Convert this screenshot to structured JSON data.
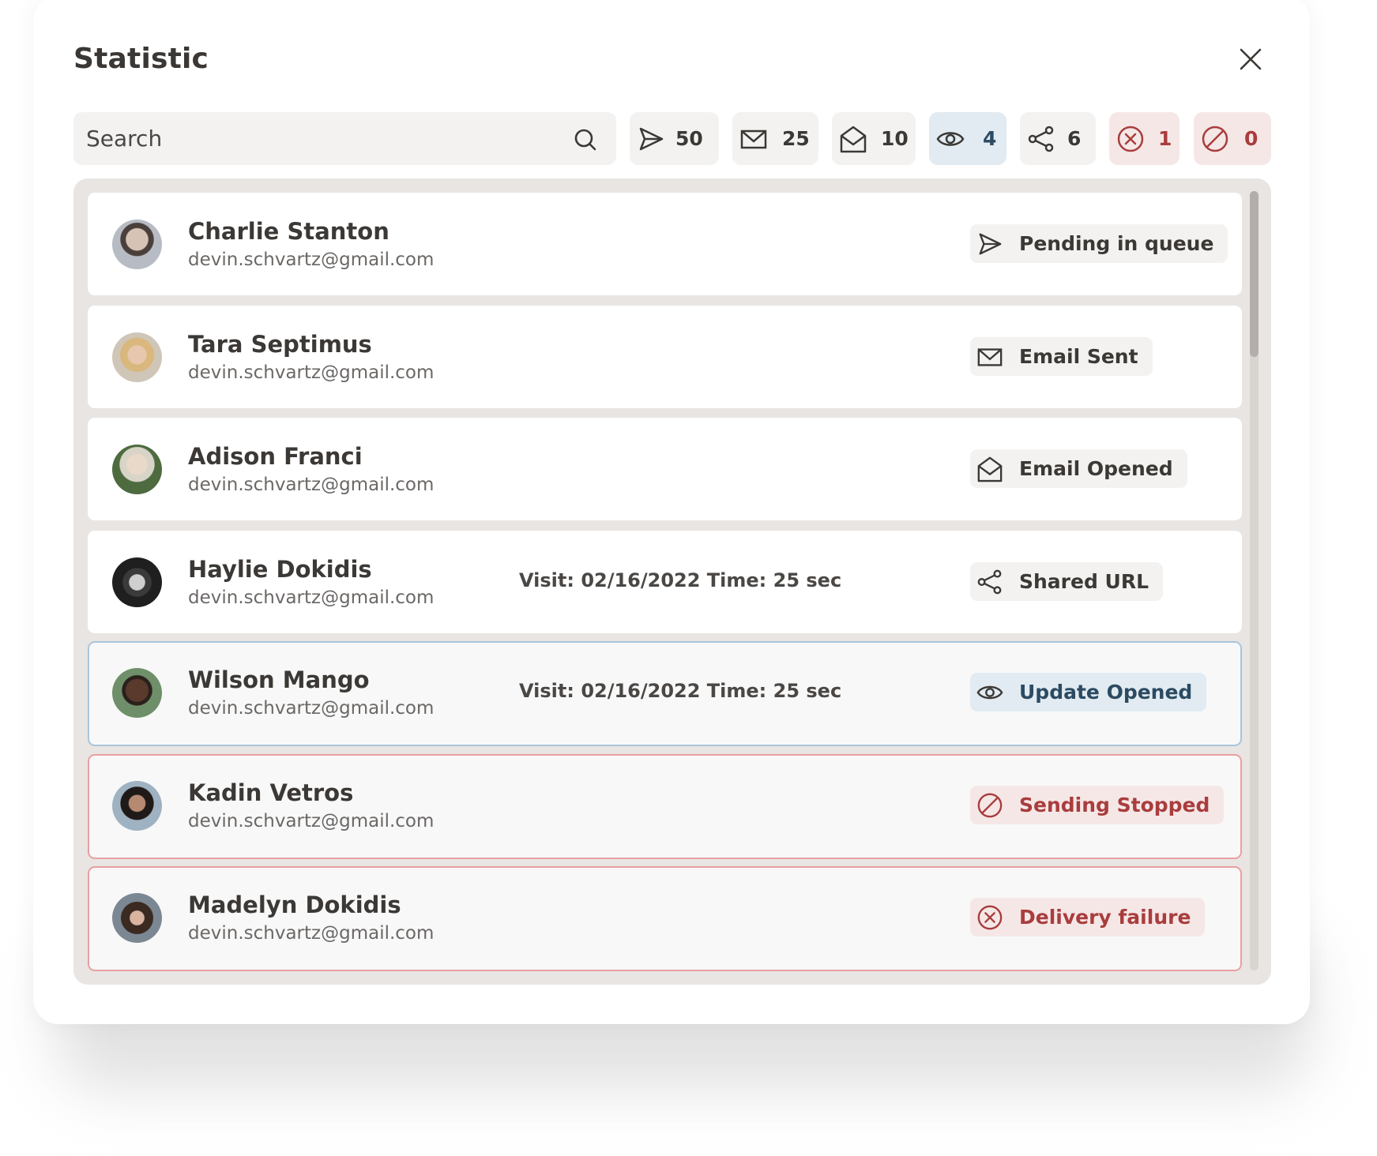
{
  "dialog": {
    "title": "Statistic",
    "close_icon": "close-icon"
  },
  "search": {
    "placeholder": "Search",
    "value": "",
    "icon": "search-icon"
  },
  "filters": [
    {
      "id": "pending",
      "icon": "send-icon",
      "count": "50",
      "tone": "neutral"
    },
    {
      "id": "sent",
      "icon": "envelope-icon",
      "count": "25",
      "tone": "neutral"
    },
    {
      "id": "opened",
      "icon": "envelope-open-icon",
      "count": "10",
      "tone": "neutral"
    },
    {
      "id": "update-opened",
      "icon": "eye-icon",
      "count": "4",
      "tone": "blue",
      "selected": true
    },
    {
      "id": "shared",
      "icon": "share-icon",
      "count": "6",
      "tone": "neutral"
    },
    {
      "id": "failure",
      "icon": "x-circle-icon",
      "count": "1",
      "tone": "red"
    },
    {
      "id": "stopped",
      "icon": "ban-icon",
      "count": "0",
      "tone": "red"
    }
  ],
  "contacts": [
    {
      "name": "Charlie Stanton",
      "email": "devin.schvartz@gmail.com",
      "visit": "",
      "status": "Pending in queue",
      "status_icon": "send-icon",
      "tone": "neutral",
      "row_state": "normal"
    },
    {
      "name": "Tara Septimus",
      "email": "devin.schvartz@gmail.com",
      "visit": "",
      "status": "Email Sent",
      "status_icon": "envelope-icon",
      "tone": "neutral",
      "row_state": "normal"
    },
    {
      "name": "Adison Franci",
      "email": "devin.schvartz@gmail.com",
      "visit": "",
      "status": "Email Opened",
      "status_icon": "envelope-open-icon",
      "tone": "neutral",
      "row_state": "normal"
    },
    {
      "name": "Haylie Dokidis",
      "email": "devin.schvartz@gmail.com",
      "visit": "Visit: 02/16/2022 Time: 25 sec",
      "status": "Shared URL",
      "status_icon": "share-icon",
      "tone": "neutral",
      "row_state": "normal"
    },
    {
      "name": "Wilson Mango",
      "email": "devin.schvartz@gmail.com",
      "visit": "Visit: 02/16/2022 Time: 25 sec",
      "status": "Update Opened",
      "status_icon": "eye-icon",
      "tone": "blue",
      "row_state": "active"
    },
    {
      "name": "Kadin Vetros",
      "email": "devin.schvartz@gmail.com",
      "visit": "",
      "status": "Sending Stopped",
      "status_icon": "ban-icon",
      "tone": "red",
      "row_state": "error"
    },
    {
      "name": "Madelyn Dokidis",
      "email": "devin.schvartz@gmail.com",
      "visit": "",
      "status": "Delivery failure",
      "status_icon": "x-circle-icon",
      "tone": "red",
      "row_state": "error"
    }
  ],
  "colors": {
    "neutral_text": "#3b3835",
    "neutral_bg": "#f3f2f0",
    "blue_text": "#2c4b62",
    "blue_bg": "#e1ebf1",
    "blue_border": "#a9c5db",
    "red_text": "#a93d3d",
    "red_bg": "#f6e7e7",
    "red_border": "#e9a0a2",
    "list_bg": "#e8e5e2"
  }
}
